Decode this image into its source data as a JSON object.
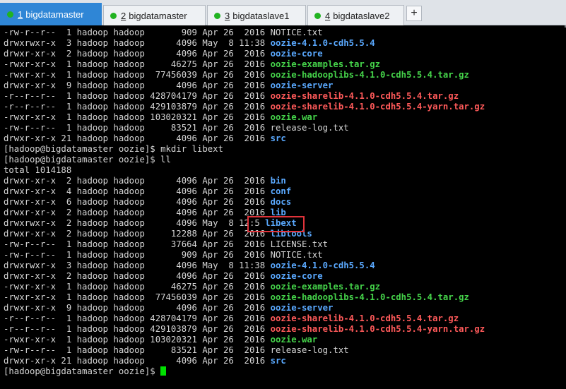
{
  "tabs": [
    {
      "num": "1",
      "label": "bigdatamaster",
      "active": true
    },
    {
      "num": "2",
      "label": "bigdatamaster",
      "active": false
    },
    {
      "num": "3",
      "label": "bigdataslave1",
      "active": false
    },
    {
      "num": "4",
      "label": "bigdataslave2",
      "active": false
    }
  ],
  "add_tab_label": "+",
  "colors": {
    "tab_active": "#2f86d6",
    "status_dot": "#21b321",
    "dir": "#5aa9ff",
    "exec": "#45d34a",
    "archive": "#ff5a5a",
    "highlight": "#e0333a"
  },
  "terminal": {
    "listing1": [
      {
        "prefix": "-rw-r--r--  1 hadoop hadoop       909 Apr 26  2016 ",
        "name": "NOTICE.txt",
        "kind": "file"
      },
      {
        "prefix": "drwxrwxr-x  3 hadoop hadoop      4096 May  8 11:38 ",
        "name": "oozie-4.1.0-cdh5.5.4",
        "kind": "dir"
      },
      {
        "prefix": "drwxr-xr-x  2 hadoop hadoop      4096 Apr 26  2016 ",
        "name": "oozie-core",
        "kind": "dir"
      },
      {
        "prefix": "-rwxr-xr-x  1 hadoop hadoop     46275 Apr 26  2016 ",
        "name": "oozie-examples.tar.gz",
        "kind": "exec"
      },
      {
        "prefix": "-rwxr-xr-x  1 hadoop hadoop  77456039 Apr 26  2016 ",
        "name": "oozie-hadooplibs-4.1.0-cdh5.5.4.tar.gz",
        "kind": "exec"
      },
      {
        "prefix": "drwxr-xr-x  9 hadoop hadoop      4096 Apr 26  2016 ",
        "name": "oozie-server",
        "kind": "dir"
      },
      {
        "prefix": "-r--r--r--  1 hadoop hadoop 428704179 Apr 26  2016 ",
        "name": "oozie-sharelib-4.1.0-cdh5.5.4.tar.gz",
        "kind": "archive"
      },
      {
        "prefix": "-r--r--r--  1 hadoop hadoop 429103879 Apr 26  2016 ",
        "name": "oozie-sharelib-4.1.0-cdh5.5.4-yarn.tar.gz",
        "kind": "archive"
      },
      {
        "prefix": "-rwxr-xr-x  1 hadoop hadoop 103020321 Apr 26  2016 ",
        "name": "oozie.war",
        "kind": "exec"
      },
      {
        "prefix": "-rw-r--r--  1 hadoop hadoop     83521 Apr 26  2016 ",
        "name": "release-log.txt",
        "kind": "file"
      },
      {
        "prefix": "drwxr-xr-x 21 hadoop hadoop      4096 Apr 26  2016 ",
        "name": "src",
        "kind": "dir"
      }
    ],
    "cmd1": "[hadoop@bigdatamaster oozie]$ mkdir libext",
    "cmd2": "[hadoop@bigdatamaster oozie]$ ll",
    "total": "total 1014188",
    "listing2": [
      {
        "prefix": "drwxr-xr-x  2 hadoop hadoop      4096 Apr 26  2016 ",
        "name": "bin",
        "kind": "dir"
      },
      {
        "prefix": "drwxr-xr-x  4 hadoop hadoop      4096 Apr 26  2016 ",
        "name": "conf",
        "kind": "dir"
      },
      {
        "prefix": "drwxr-xr-x  6 hadoop hadoop      4096 Apr 26  2016 ",
        "name": "docs",
        "kind": "dir"
      },
      {
        "prefix": "drwxr-xr-x  2 hadoop hadoop      4096 Apr 26  2016 ",
        "name": "lib",
        "kind": "dir"
      },
      {
        "prefix": "drwxrwxr-x  2 hadoop hadoop      4096 May  8 12:5 ",
        "name": "libext",
        "kind": "dir"
      },
      {
        "prefix": "drwxr-xr-x  2 hadoop hadoop     12288 Apr 26  2016 ",
        "name": "libtools",
        "kind": "dir"
      },
      {
        "prefix": "-rw-r--r--  1 hadoop hadoop     37664 Apr 26  2016 ",
        "name": "LICENSE.txt",
        "kind": "file"
      },
      {
        "prefix": "-rw-r--r--  1 hadoop hadoop       909 Apr 26  2016 ",
        "name": "NOTICE.txt",
        "kind": "file"
      },
      {
        "prefix": "drwxrwxr-x  3 hadoop hadoop      4096 May  8 11:38 ",
        "name": "oozie-4.1.0-cdh5.5.4",
        "kind": "dir"
      },
      {
        "prefix": "drwxr-xr-x  2 hadoop hadoop      4096 Apr 26  2016 ",
        "name": "oozie-core",
        "kind": "dir"
      },
      {
        "prefix": "-rwxr-xr-x  1 hadoop hadoop     46275 Apr 26  2016 ",
        "name": "oozie-examples.tar.gz",
        "kind": "exec"
      },
      {
        "prefix": "-rwxr-xr-x  1 hadoop hadoop  77456039 Apr 26  2016 ",
        "name": "oozie-hadooplibs-4.1.0-cdh5.5.4.tar.gz",
        "kind": "exec"
      },
      {
        "prefix": "drwxr-xr-x  9 hadoop hadoop      4096 Apr 26  2016 ",
        "name": "oozie-server",
        "kind": "dir"
      },
      {
        "prefix": "-r--r--r--  1 hadoop hadoop 428704179 Apr 26  2016 ",
        "name": "oozie-sharelib-4.1.0-cdh5.5.4.tar.gz",
        "kind": "archive"
      },
      {
        "prefix": "-r--r--r--  1 hadoop hadoop 429103879 Apr 26  2016 ",
        "name": "oozie-sharelib-4.1.0-cdh5.5.4-yarn.tar.gz",
        "kind": "archive"
      },
      {
        "prefix": "-rwxr-xr-x  1 hadoop hadoop 103020321 Apr 26  2016 ",
        "name": "oozie.war",
        "kind": "exec"
      },
      {
        "prefix": "-rw-r--r--  1 hadoop hadoop     83521 Apr 26  2016 ",
        "name": "release-log.txt",
        "kind": "file"
      },
      {
        "prefix": "drwxr-xr-x 21 hadoop hadoop      4096 Apr 26  2016 ",
        "name": "src",
        "kind": "dir"
      }
    ],
    "prompt": "[hadoop@bigdatamaster oozie]$ "
  }
}
